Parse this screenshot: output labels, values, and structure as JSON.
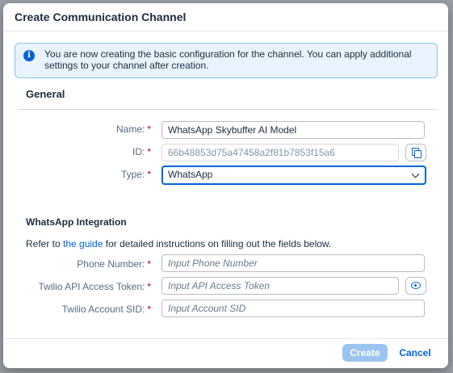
{
  "dialog": {
    "title": "Create Communication Channel"
  },
  "info": {
    "text": "You are now creating the basic configuration for the channel. You can apply additional settings to your channel after creation."
  },
  "general": {
    "title": "General",
    "fields": {
      "name": {
        "label": "Name:",
        "value": "WhatsApp Skybuffer AI Model"
      },
      "id": {
        "label": "ID:",
        "value": "66b48853d75a47458a2f81b7853f15a6"
      },
      "type": {
        "label": "Type:",
        "value": "WhatsApp"
      }
    }
  },
  "integration": {
    "title": "WhatsApp Integration",
    "help_prefix": "Refer to ",
    "help_link": "the guide",
    "help_suffix": " for detailed instructions on filling out the fields below.",
    "fields": {
      "phone": {
        "label": "Phone Number:",
        "placeholder": "Input Phone Number"
      },
      "token": {
        "label": "Twilio API Access Token:",
        "placeholder": "Input API Access Token"
      },
      "sid": {
        "label": "Twilio Account SID:",
        "placeholder": "Input Account SID"
      }
    }
  },
  "footer": {
    "create_label": "Create",
    "cancel_label": "Cancel"
  },
  "required_marker": "*"
}
